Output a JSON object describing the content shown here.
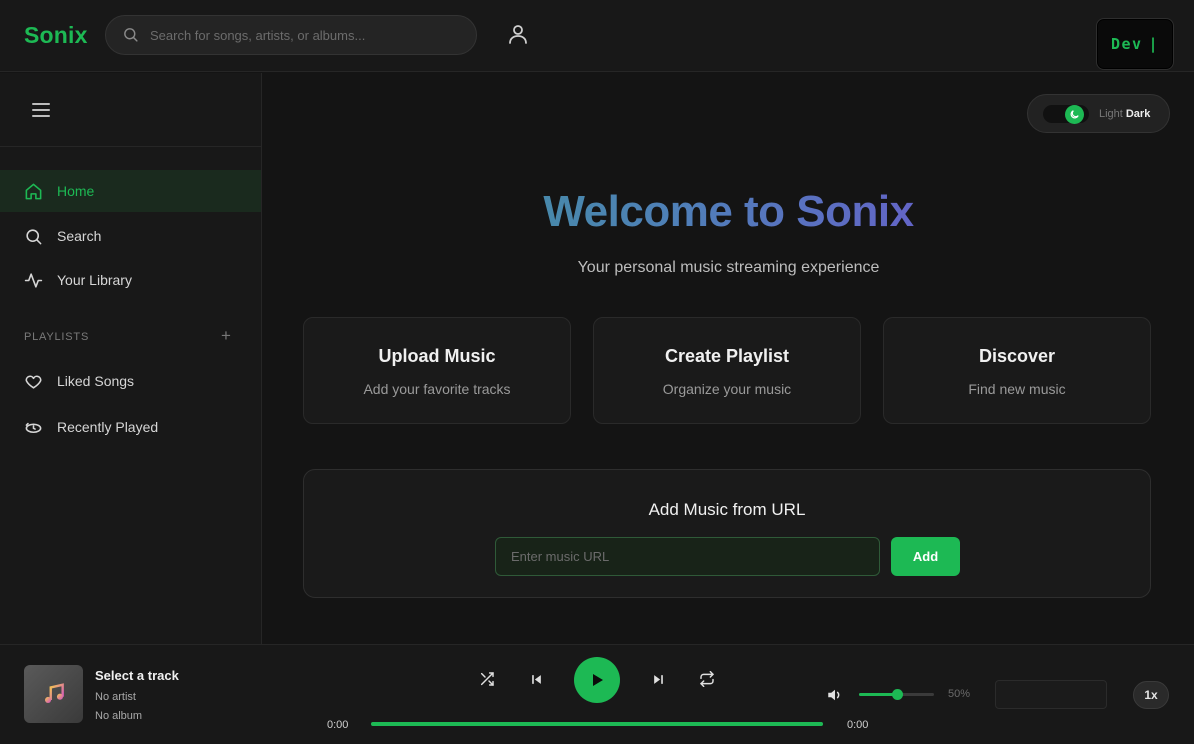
{
  "app": {
    "logo": "Sonix",
    "accent_color": "#1db954",
    "background_color": "#141414"
  },
  "header": {
    "search_placeholder": "Search for songs, artists, or albums...",
    "search_value": "",
    "dev_badge": "Dev",
    "dev_cursor": "|"
  },
  "sidebar": {
    "nav": [
      {
        "label": "Home",
        "icon": "home-icon",
        "active": true
      },
      {
        "label": "Search",
        "icon": "search-icon",
        "active": false
      },
      {
        "label": "Your Library",
        "icon": "activity-icon",
        "active": false
      }
    ],
    "playlists_label": "PLAYLISTS",
    "playlists_add": "+",
    "playlists": [
      {
        "label": "Liked Songs",
        "icon": "heart-icon"
      },
      {
        "label": "Recently Played",
        "icon": "recent-icon"
      }
    ]
  },
  "theme_toggle": {
    "light_label": "Light",
    "dark_label": "Dark",
    "active": "Dark"
  },
  "main": {
    "title": "Welcome to Sonix",
    "subtitle": "Your personal music streaming experience",
    "cards": [
      {
        "title": "Upload Music",
        "desc": "Add your favorite tracks"
      },
      {
        "title": "Create Playlist",
        "desc": "Organize your music"
      },
      {
        "title": "Discover",
        "desc": "Find new music"
      }
    ],
    "url_section": {
      "title": "Add Music from URL",
      "placeholder": "Enter music URL",
      "value": "",
      "button": "Add"
    }
  },
  "player": {
    "track_title": "Select a track",
    "artist": "No artist",
    "album": "No album",
    "current_time": "0:00",
    "total_time": "0:00",
    "progress": 1.0,
    "volume_label": "50%",
    "volume": 0.5,
    "speed": "1x"
  }
}
